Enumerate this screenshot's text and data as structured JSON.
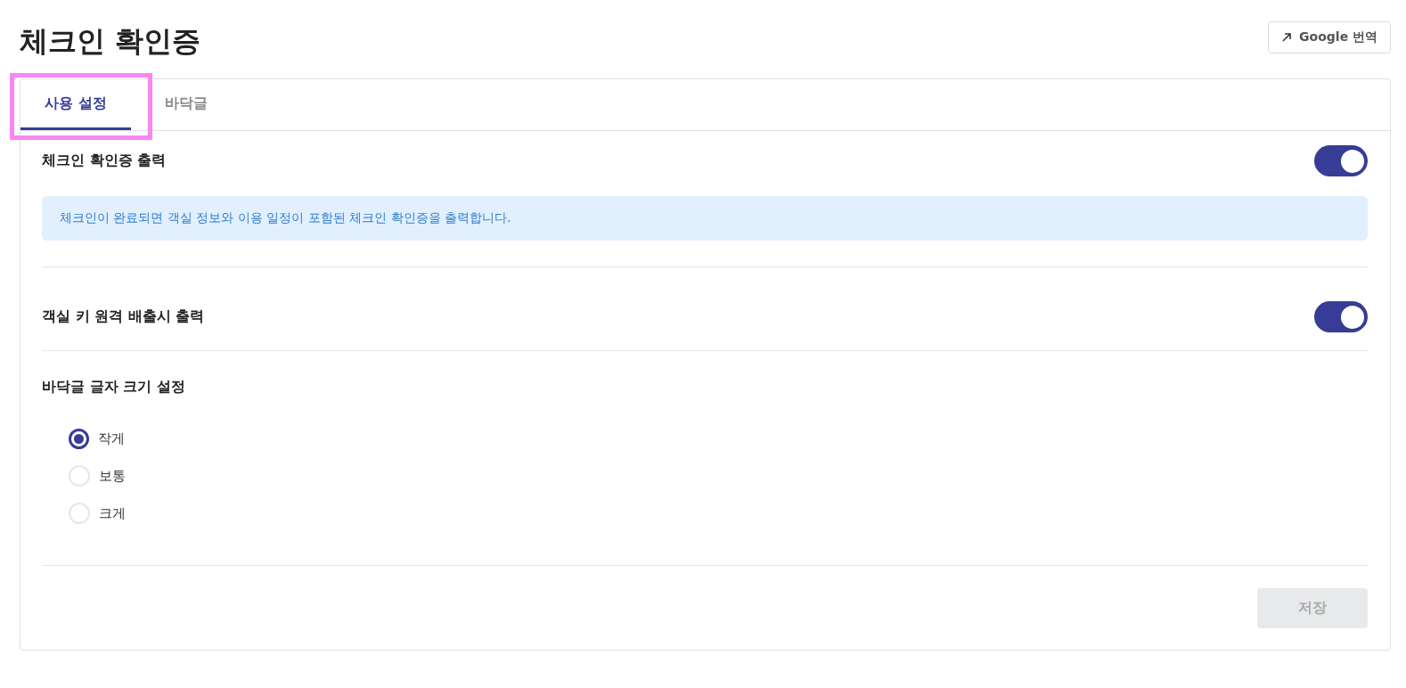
{
  "page": {
    "title": "체크인 확인증",
    "translate_button": "Google 번역"
  },
  "tabs": [
    {
      "label": "사용 설정",
      "selected": true,
      "highlighted": true
    },
    {
      "label": "바닥글",
      "selected": false,
      "highlighted": false
    }
  ],
  "settings": [
    {
      "kind": "toggle",
      "label": "체크인 확인증 출력",
      "on": true,
      "info": "체크인이 완료되면 객실 정보와 이용 일정이 포함된 체크인 확인증을 출력합니다."
    },
    {
      "kind": "toggle",
      "label": "객실 키 원격 배출시 출력",
      "on": true
    },
    {
      "kind": "radio",
      "label": "바닥글 글자 크기 설정",
      "options": [
        {
          "label": "작게",
          "selected": true
        },
        {
          "label": "보통",
          "selected": false
        },
        {
          "label": "크게",
          "selected": false
        }
      ]
    }
  ],
  "save_button": {
    "label": "저장",
    "disabled": true
  }
}
